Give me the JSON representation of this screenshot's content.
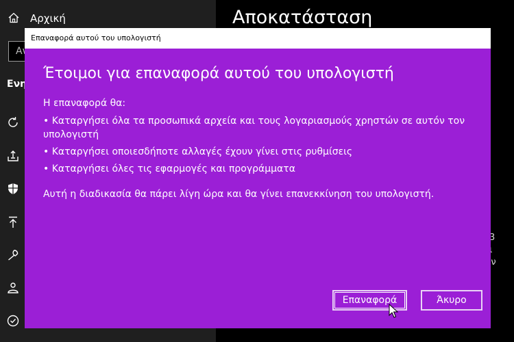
{
  "sidebar": {
    "home_label": "Αρχική",
    "search_fragment": "Αν",
    "section_fragment": "Ενη",
    "icons": [
      "sync-icon",
      "upload-tray-icon",
      "shield-icon",
      "backup-arrow-icon",
      "wrench-icon",
      "person-sync-icon",
      "check-circle-icon"
    ]
  },
  "main": {
    "title": "Αποκατάσταση",
    "fragments": [
      "3",
      "ι",
      "ιν",
      "ις"
    ]
  },
  "dialog": {
    "window_title": "Επαναφορά αυτού του υπολογιστή",
    "heading": "Έτοιμοι για επαναφορά αυτού του υπολογιστή",
    "intro": "Η επαναφορά θα:",
    "items": [
      "• Καταργήσει όλα τα προσωπικά αρχεία και τους λογαριασμούς χρηστών σε αυτόν τον υπολογιστή",
      "• Καταργήσει οποιεσδήποτε αλλαγές έχουν γίνει στις ρυθμίσεις",
      "• Καταργήσει όλες τις εφαρμογές και προγράμματα"
    ],
    "note": "Αυτή η διαδικασία θα πάρει λίγη ώρα και θα γίνει επανεκκίνηση του υπολογιστή.",
    "reset_label": "Επαναφορά",
    "cancel_label": "Άκυρο",
    "accent_color": "#9b1fd6"
  }
}
